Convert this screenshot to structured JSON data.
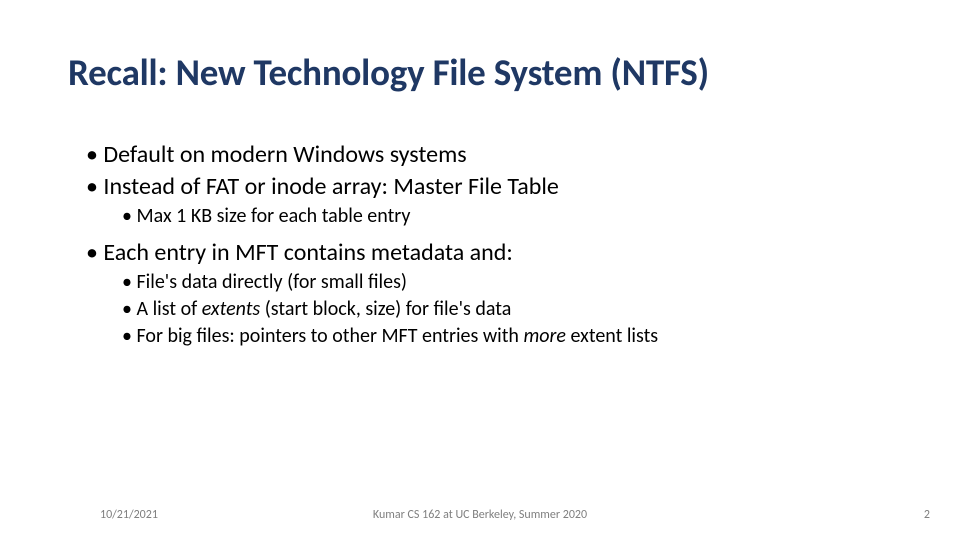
{
  "title": "Recall: New Technology File System (NTFS)",
  "bullets": {
    "b1": "Default on modern Windows systems",
    "b2": "Instead of FAT or inode array: Master File Table",
    "b2a": "Max 1 KB size for each table entry",
    "b3": "Each entry in MFT contains metadata and:",
    "b3a": "File's data directly (for small files)",
    "b3b_pre": "A list of ",
    "b3b_em": "extents",
    "b3b_post": " (start block, size) for file's data",
    "b3c_pre": "For big files: pointers to other MFT entries with ",
    "b3c_em": "more",
    "b3c_post": " extent lists"
  },
  "footer": {
    "date": "10/21/2021",
    "center": "Kumar CS 162 at UC Berkeley, Summer 2020",
    "page": "2"
  }
}
